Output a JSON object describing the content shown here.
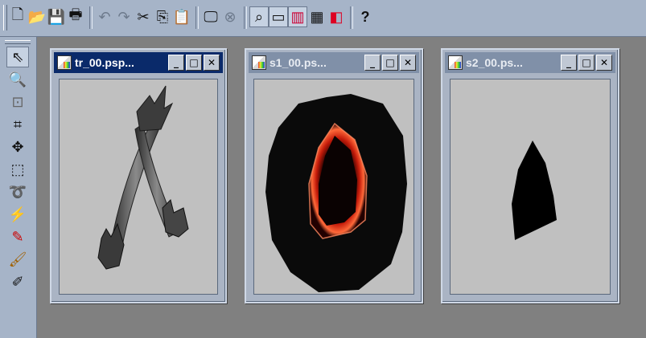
{
  "toolbar": {
    "buttons": [
      {
        "name": "new-icon",
        "glyph": "🗋"
      },
      {
        "name": "open-icon",
        "glyph": "📂"
      },
      {
        "name": "save-icon",
        "glyph": "💾"
      },
      {
        "name": "print-icon",
        "glyph": "🖶"
      },
      {
        "name": "undo-icon",
        "glyph": "↶"
      },
      {
        "name": "redo-icon",
        "glyph": "↷"
      },
      {
        "name": "cut-icon",
        "glyph": "✂"
      },
      {
        "name": "copy-icon",
        "glyph": "⎘"
      },
      {
        "name": "paste-icon",
        "glyph": "📋"
      },
      {
        "name": "full-screen-preview-icon",
        "glyph": "🖵"
      },
      {
        "name": "normal-viewing-icon",
        "glyph": "⊗"
      },
      {
        "name": "toggle-tool-palette-icon",
        "glyph": "⌕"
      },
      {
        "name": "toggle-tool-options-icon",
        "glyph": "▭"
      },
      {
        "name": "toggle-color-palette-icon",
        "glyph": "▥"
      },
      {
        "name": "toggle-histogram-icon",
        "glyph": "▦"
      },
      {
        "name": "toggle-layer-palette-icon",
        "glyph": "◧"
      },
      {
        "name": "context-help-icon",
        "glyph": "?"
      }
    ]
  },
  "palette": {
    "tools": [
      {
        "name": "arrow-tool-icon",
        "glyph": "⇖"
      },
      {
        "name": "zoom-tool-icon",
        "glyph": "🔍"
      },
      {
        "name": "deform-tool-icon",
        "glyph": "⊡"
      },
      {
        "name": "crop-tool-icon",
        "glyph": "⌗"
      },
      {
        "name": "move-tool-icon",
        "glyph": "✥"
      },
      {
        "name": "selection-tool-icon",
        "glyph": "⬚"
      },
      {
        "name": "freehand-lasso-icon",
        "glyph": "➰"
      },
      {
        "name": "magic-wand-icon",
        "glyph": "⚡"
      },
      {
        "name": "dropper-tool-icon",
        "glyph": "✎"
      },
      {
        "name": "paintbrush-tool-icon",
        "glyph": "🖌"
      },
      {
        "name": "clone-brush-icon",
        "glyph": "✐"
      }
    ]
  },
  "windows": [
    {
      "title": "tr_00.psp..."
    },
    {
      "title": "s1_00.ps..."
    },
    {
      "title": "s2_00.ps..."
    }
  ],
  "window_buttons": {
    "minimize": "_",
    "maximize": "□",
    "close": "✕"
  }
}
